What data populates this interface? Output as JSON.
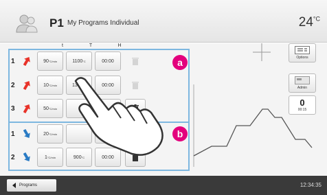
{
  "header": {
    "program_id": "P1",
    "program_name": "My Programs Individual",
    "temperature": "24",
    "temperature_unit": "°C"
  },
  "columns": [
    "t",
    "T",
    "H"
  ],
  "groups": [
    {
      "badge": "a",
      "rows": [
        {
          "num": "1",
          "rate": "90",
          "rate_unit": "°C/min",
          "temp": "1100",
          "temp_unit": "°C",
          "hold": "00:00",
          "delete_enabled": false,
          "color": "#e8332a"
        },
        {
          "num": "2",
          "rate": "10",
          "rate_unit": "°C/min",
          "temp": "1300",
          "temp_unit": "°C",
          "hold": "00:00",
          "delete_enabled": false,
          "color": "#e8332a"
        },
        {
          "num": "3",
          "rate": "50",
          "rate_unit": "°C/min",
          "temp": "",
          "temp_unit": "",
          "hold": "",
          "delete_enabled": true,
          "color": "#e8332a"
        }
      ]
    },
    {
      "badge": "b",
      "rows": [
        {
          "num": "1",
          "rate": "20",
          "rate_unit": "°C/min",
          "temp": "",
          "temp_unit": "",
          "hold": "",
          "delete_enabled": false,
          "color": "#2a7bc4"
        },
        {
          "num": "2",
          "rate": "1",
          "rate_unit": "°C/min",
          "temp": "900",
          "temp_unit": "°C",
          "hold": "00:00",
          "delete_enabled": true,
          "color": "#2a7bc4"
        }
      ]
    }
  ],
  "sidebar": {
    "options_label": "Options",
    "admin_label": "Admin",
    "counter_value": "0",
    "counter_time": "00:15"
  },
  "footer": {
    "programs_label": "Programs",
    "clock": "12:34:35"
  },
  "colors": {
    "badge": "#e3007d",
    "group_border": "#7db7e0",
    "heating_arrow": "#e8332a",
    "cooling_arrow": "#2a7bc4"
  }
}
